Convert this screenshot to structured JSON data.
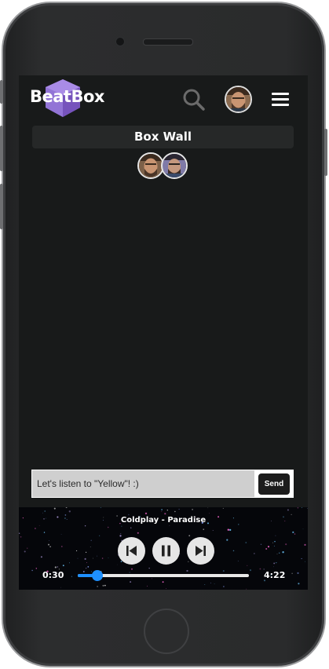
{
  "app": {
    "name": "BeatBox",
    "brand_color": "#9b7fd9"
  },
  "header": {
    "search_icon": "search-icon",
    "menu_icon": "hamburger-menu-icon"
  },
  "wall": {
    "title": "Box Wall",
    "members_count": 2
  },
  "chat": {
    "input_value": "Let's listen to \"Yellow\"! :)",
    "send_label": "Send"
  },
  "player": {
    "track": "Coldplay - Paradise",
    "elapsed": "0:30",
    "duration": "4:22",
    "progress_fraction": 0.115,
    "accent_color": "#1e90ff",
    "state": "playing"
  }
}
